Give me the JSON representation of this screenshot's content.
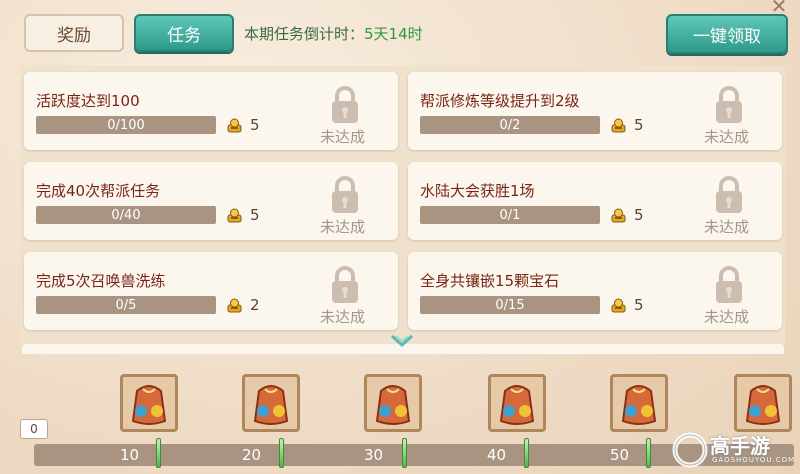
{
  "tabs": {
    "reward": "奖励",
    "task": "任务"
  },
  "countdown": {
    "label": "本期任务倒计时：",
    "value": "5天14时"
  },
  "claim_all": "一键领取",
  "tasks": [
    {
      "title": "活跃度达到100",
      "progress": "0/100",
      "reward": "5",
      "status": "未达成"
    },
    {
      "title": "帮派修炼等级提升到2级",
      "progress": "0/2",
      "reward": "5",
      "status": "未达成"
    },
    {
      "title": "完成40次帮派任务",
      "progress": "0/40",
      "reward": "5",
      "status": "未达成"
    },
    {
      "title": "水陆大会获胜1场",
      "progress": "0/1",
      "reward": "5",
      "status": "未达成"
    },
    {
      "title": "完成5次召唤兽洗练",
      "progress": "0/5",
      "reward": "2",
      "status": "未达成"
    },
    {
      "title": "全身共镶嵌15颗宝石",
      "progress": "0/15",
      "reward": "5",
      "status": "未达成"
    }
  ],
  "milestones": [
    "10",
    "20",
    "30",
    "40",
    "50"
  ],
  "progress_start": "0",
  "watermark": {
    "name": "高手游",
    "url": "GAOSHOUYOU.COM"
  },
  "colors": {
    "accent": "#2f9a8b",
    "task_title": "#7a2515",
    "countdown": "#2f9a3b"
  },
  "icons": {
    "coin": "gold-ingot-icon",
    "lock": "padlock-icon",
    "chest": "reward-bag-icon"
  }
}
